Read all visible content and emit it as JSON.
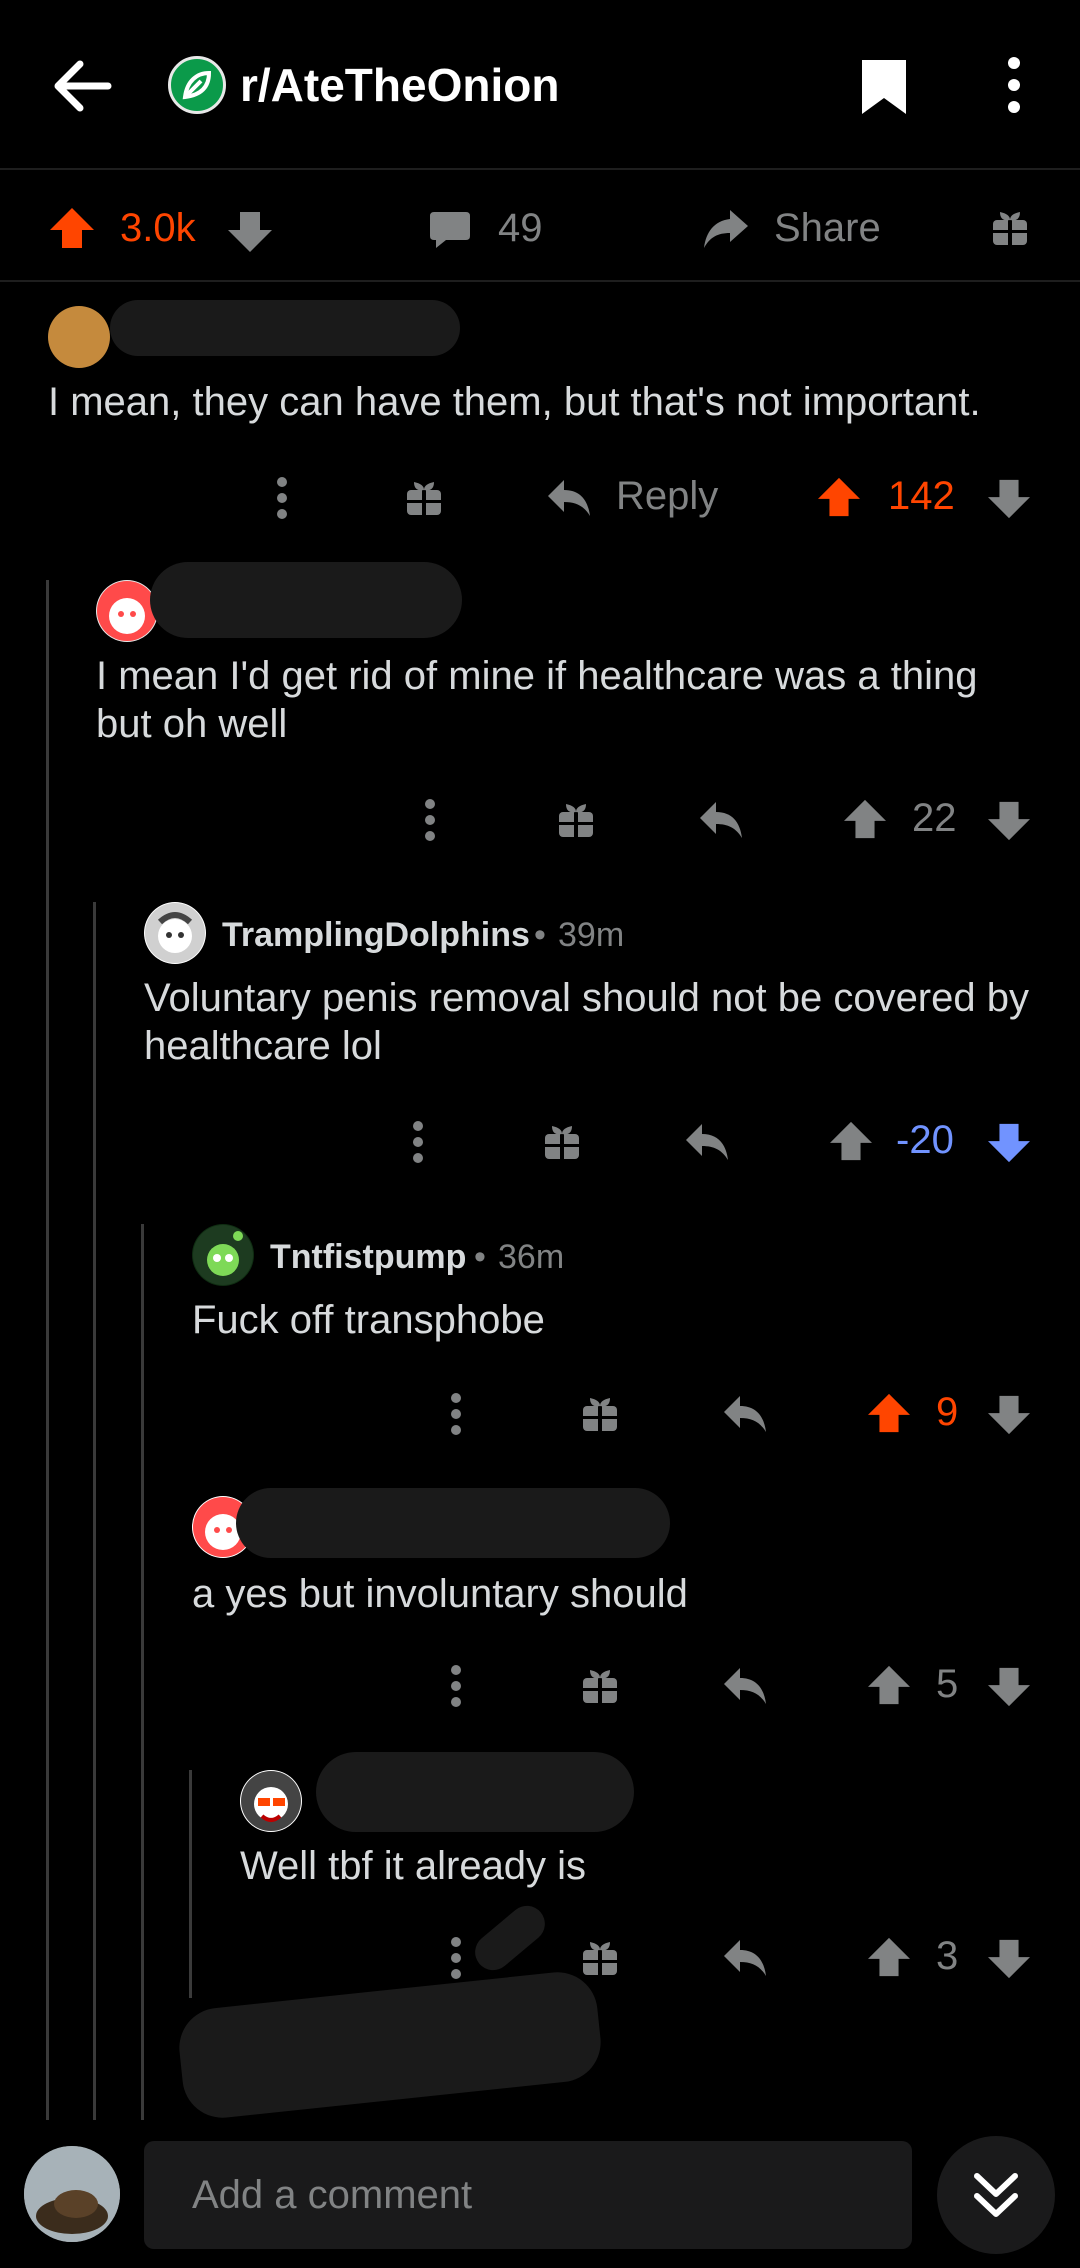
{
  "header": {
    "subreddit": "r/AteTheOnion",
    "icons": [
      "back-arrow-icon",
      "subreddit-icon",
      "bookmark-icon",
      "more-vertical-icon"
    ]
  },
  "post_bar": {
    "score": "3.0k",
    "comments": "49",
    "share_label": "Share"
  },
  "comments": [
    {
      "user": "",
      "time": "",
      "text": "I mean, they can have them, but that's not important.",
      "score": "142",
      "vote": "up",
      "reply_label": "Reply",
      "depth": 0
    },
    {
      "user": "",
      "time": "",
      "text": "I mean I'd get rid of mine if healthcare was a thing but oh well",
      "score": "22",
      "vote": "none",
      "depth": 1
    },
    {
      "user": "TramplingDolphins",
      "time": "39m",
      "text": "Voluntary penis removal should not be covered by healthcare lol",
      "score": "-20",
      "vote": "down",
      "depth": 2
    },
    {
      "user": "Tntfistpump",
      "time": "36m",
      "text": "Fuck off transphobe",
      "score": "9",
      "vote": "up",
      "depth": 3
    },
    {
      "user": "",
      "time": "",
      "text": "a yes but involuntary should",
      "score": "5",
      "vote": "none",
      "depth": 3
    },
    {
      "user": "",
      "time": "",
      "text": "Well tbf it already is",
      "score": "3",
      "vote": "none",
      "depth": 4
    }
  ],
  "footer": {
    "placeholder": "Add a comment"
  },
  "colors": {
    "upvote": "#ff4500",
    "downvote": "#7193ff",
    "muted": "#818384"
  }
}
